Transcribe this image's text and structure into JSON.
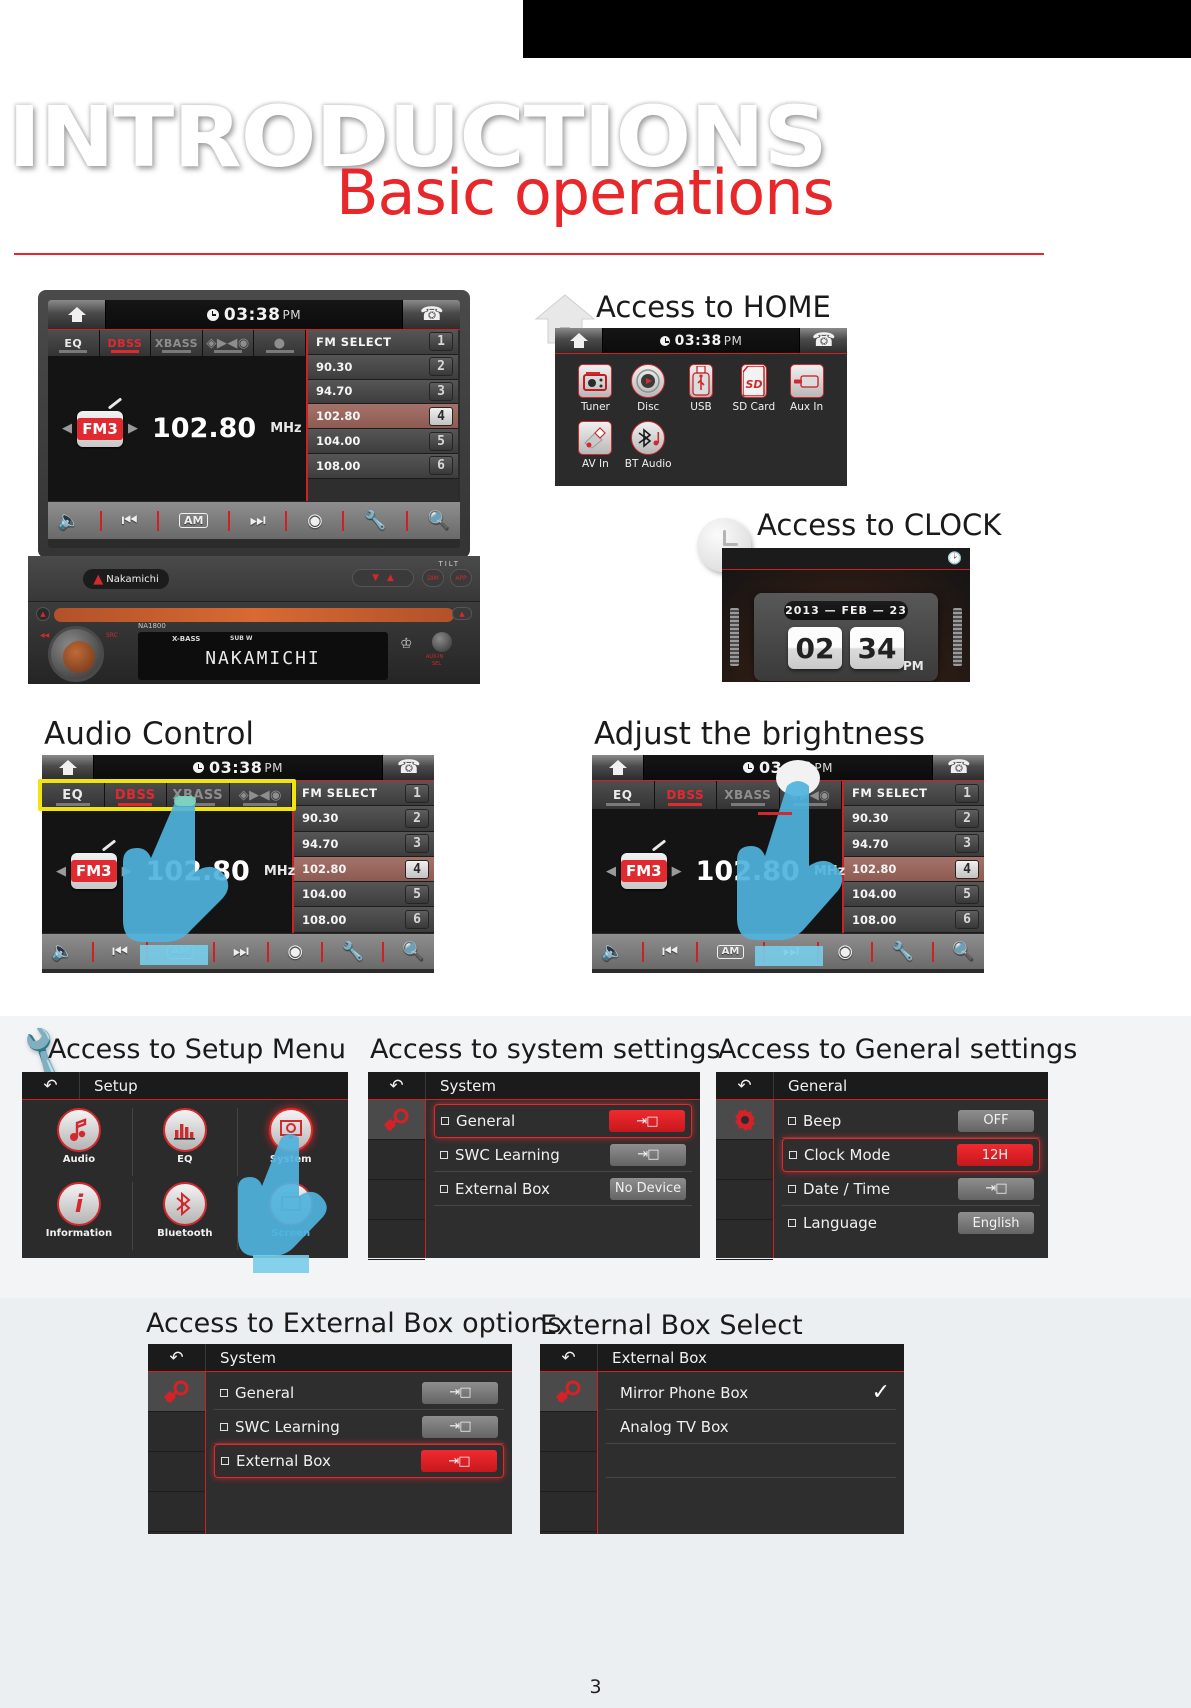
{
  "header": {
    "title_outline": "INTRODUCTIONS",
    "title_red": "Basic operations"
  },
  "page_number": "3",
  "sections": {
    "home": "Access to HOME",
    "clock": "Access to CLOCK",
    "audio_control": "Audio Control",
    "brightness": "Adjust the brightness",
    "setup_menu": "Access to Setup Menu",
    "system_settings": "Access to system settings",
    "general_settings": "Access to General settings",
    "external_box_options": "Access to External Box options",
    "external_box_select": "External Box Select"
  },
  "radio": {
    "clock_time": "03:38",
    "clock_ampm": "PM",
    "eq_buttons": [
      {
        "label": "EQ",
        "active": false
      },
      {
        "label": "DBSS",
        "active": true
      },
      {
        "label": "XBASS",
        "active": false
      },
      {
        "label": "BAL-FAD",
        "active": false
      },
      {
        "label": "MIC",
        "active": false
      }
    ],
    "band": "FM3",
    "frequency": "102.80",
    "unit": "MHz",
    "presets": [
      {
        "label": "FM SELECT",
        "num": "1",
        "highlighted": false
      },
      {
        "label": "90.30",
        "num": "2",
        "highlighted": false
      },
      {
        "label": "94.70",
        "num": "3",
        "highlighted": false
      },
      {
        "label": "102.80",
        "num": "4",
        "highlighted": true
      },
      {
        "label": "104.00",
        "num": "5",
        "highlighted": false
      },
      {
        "label": "108.00",
        "num": "6",
        "highlighted": false
      }
    ],
    "transport": [
      "volume-icon",
      "prev-track-icon",
      "AM",
      "next-track-icon",
      "disc-icon",
      "wrench-icon",
      "search-icon"
    ],
    "am_label": "AM"
  },
  "device": {
    "brand": "Nakamichi",
    "model": "NA1800",
    "display_text": "NAKAMICHI",
    "tilt_label": "TILT",
    "dim_label": "DIM",
    "app_label": "APP",
    "bass_label": "X-BASS",
    "sub_label": "SUB W",
    "aux_label": "AUX-IN",
    "sel_label": "SEL",
    "pwr_label": "PWR",
    "src_label": "SRC"
  },
  "home_menu": {
    "clock_time": "03:38",
    "clock_ampm": "PM",
    "items": [
      {
        "label": "Tuner",
        "icon": "radio-icon"
      },
      {
        "label": "Disc",
        "icon": "disc-icon"
      },
      {
        "label": "USB",
        "icon": "usb-icon"
      },
      {
        "label": "SD Card",
        "icon": "sdcard-icon"
      },
      {
        "label": "Aux In",
        "icon": "auxin-icon"
      },
      {
        "label": "AV In",
        "icon": "avin-icon"
      },
      {
        "label": "BT Audio",
        "icon": "bluetooth-audio-icon"
      }
    ]
  },
  "clock_screen": {
    "year": "2013",
    "month": "FEB",
    "day": "23",
    "hour": "02",
    "minute": "34",
    "ampm": "PM",
    "separator": "—"
  },
  "setup_menu": {
    "title": "Setup",
    "items": [
      {
        "label": "Audio",
        "icon": "music-note-icon",
        "selected": false
      },
      {
        "label": "EQ",
        "icon": "equalizer-icon",
        "selected": false
      },
      {
        "label": "System",
        "icon": "system-screen-icon",
        "selected": true
      },
      {
        "label": "Information",
        "icon": "information-icon",
        "selected": false
      },
      {
        "label": "Bluetooth",
        "icon": "bluetooth-icon",
        "selected": false
      },
      {
        "label": "Screen",
        "icon": "screen-icon",
        "selected": false
      }
    ]
  },
  "system_settings": {
    "title": "System",
    "rows": [
      {
        "label": "General",
        "value": "enter-icon",
        "type": "enter",
        "selected": true
      },
      {
        "label": "SWC Learning",
        "value": "enter-icon",
        "type": "enter",
        "selected": false
      },
      {
        "label": "External Box",
        "value": "No Device",
        "type": "text",
        "selected": false
      }
    ]
  },
  "general_settings": {
    "title": "General",
    "rows": [
      {
        "label": "Beep",
        "value": "OFF",
        "type": "text",
        "selected": false
      },
      {
        "label": "Clock Mode",
        "value": "12H",
        "type": "text",
        "selected": true
      },
      {
        "label": "Date / Time",
        "value": "enter-icon",
        "type": "enter",
        "selected": false
      },
      {
        "label": "Language",
        "value": "English",
        "type": "text",
        "selected": false
      }
    ]
  },
  "external_box_options": {
    "title": "System",
    "rows": [
      {
        "label": "General",
        "value": "enter-icon",
        "type": "enter",
        "selected": false
      },
      {
        "label": "SWC Learning",
        "value": "enter-icon",
        "type": "enter",
        "selected": false
      },
      {
        "label": "External Box",
        "value": "enter-icon",
        "type": "enter",
        "selected": true
      }
    ]
  },
  "external_box_select": {
    "title": "External Box",
    "rows": [
      {
        "label": "Mirror Phone Box",
        "checked": true
      },
      {
        "label": "Analog TV Box",
        "checked": false
      }
    ]
  }
}
